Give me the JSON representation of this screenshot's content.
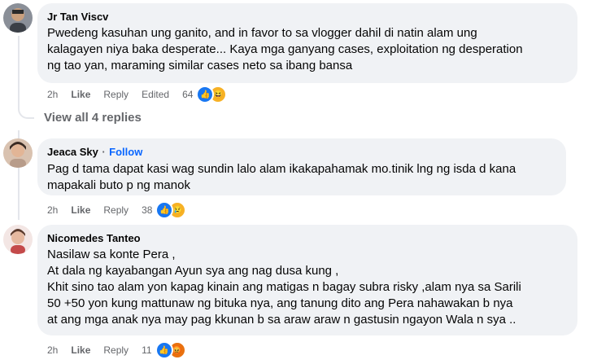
{
  "comments": [
    {
      "author": "Jr Tan Viscv",
      "follow": "",
      "lines": [
        "Pwedeng kasuhan ung ganito, and in favor to sa vlogger dahil di natin alam ung",
        "kalagayen niya baka desperate... Kaya mga ganyang cases, exploitation ng desperation",
        "ng tao yan, maraming similar cases neto sa ibang bansa"
      ],
      "time": "2h",
      "like": "Like",
      "reply": "Reply",
      "edited": "Edited",
      "reaction_count": "64",
      "reactions": [
        "like-icon",
        "haha-icon"
      ]
    },
    {
      "author": "Jeaca Sky",
      "follow_sep": "·",
      "follow": "Follow",
      "lines": [
        "Pag d tama dapat kasi wag sundin lalo alam ikakapahamak mo.tinik lng ng isda d kana",
        "mapakali buto p ng manok"
      ],
      "time": "2h",
      "like": "Like",
      "reply": "Reply",
      "reaction_count": "38",
      "reactions": [
        "like-icon",
        "sad-icon"
      ]
    },
    {
      "author": "Nicomedes Tanteo",
      "follow": "",
      "lines": [
        "Nasilaw sa konte Pera ,",
        "At dala ng kayabangan Ayun sya ang nag dusa kung ,",
        "Khit sino tao alam yon kapag kinain ang matigas n bagay subra risky ,alam nya sa Sarili",
        "50 +50 yon kung mattunaw ng bituka nya, ang tanung dito ang Pera nahawakan b nya",
        "at ang mga anak nya may pag kkunan b sa araw araw n gastusin ngayon Wala n sya .."
      ],
      "time": "2h",
      "like": "Like",
      "reply": "Reply",
      "reaction_count": "11",
      "reactions": [
        "like-icon",
        "angry-icon"
      ]
    }
  ],
  "view_replies": "View all 4 replies",
  "colors": {
    "bubble": "#f0f2f5",
    "link_blue": "#0866ff",
    "meta_gray": "#65676b"
  }
}
